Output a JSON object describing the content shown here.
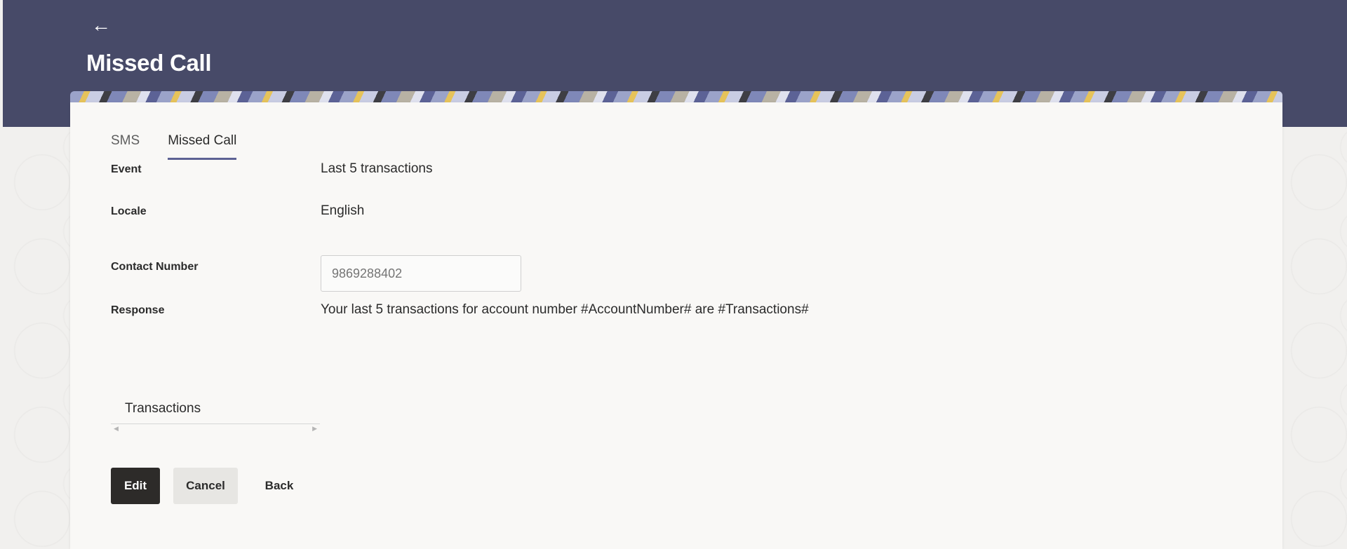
{
  "header": {
    "title": "Missed Call"
  },
  "tabs": [
    {
      "label": "SMS",
      "active": false
    },
    {
      "label": "Missed Call",
      "active": true
    }
  ],
  "fields": {
    "event": {
      "label": "Event",
      "value": "Last 5 transactions"
    },
    "locale": {
      "label": "Locale",
      "value": "English"
    },
    "contact_number": {
      "label": "Contact Number",
      "placeholder": "9869288402"
    },
    "response": {
      "label": "Response",
      "value": "Your last 5 transactions for account number #AccountNumber# are #Transactions#"
    }
  },
  "transactions_tab": {
    "label": "Transactions"
  },
  "buttons": {
    "edit": "Edit",
    "cancel": "Cancel",
    "back": "Back"
  },
  "colors": {
    "header_bg": "#474a68",
    "tab_underline": "#5d6294",
    "primary_button": "#2d2b29",
    "secondary_button": "#e7e6e3"
  },
  "icons": {
    "back": "left-arrow"
  }
}
